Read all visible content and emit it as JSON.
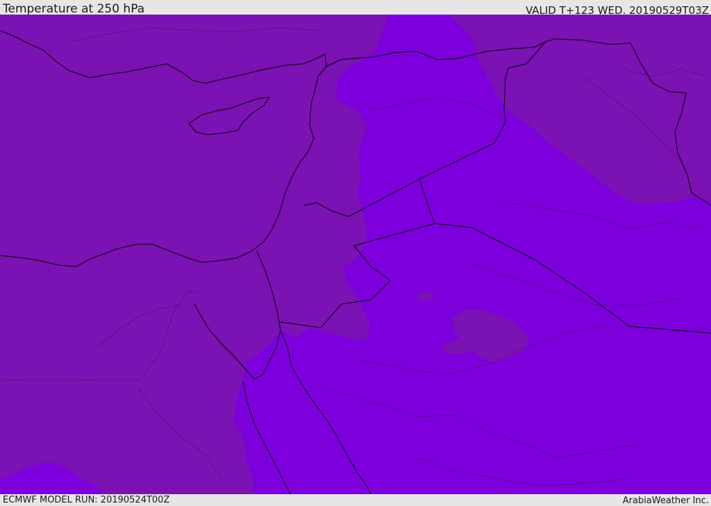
{
  "header": {
    "title": "Temperature at 250 hPa",
    "valid": "VALID T+123 WED. 20190529T03Z"
  },
  "footer": {
    "model_run": "ECMWF MODEL RUN: 20190524T00Z",
    "credit": "ArabiaWeather Inc."
  },
  "map": {
    "colors": {
      "dark_purple": "#7a12b4",
      "bright_violet": "#7d00dc",
      "border_line": "#000000"
    }
  }
}
